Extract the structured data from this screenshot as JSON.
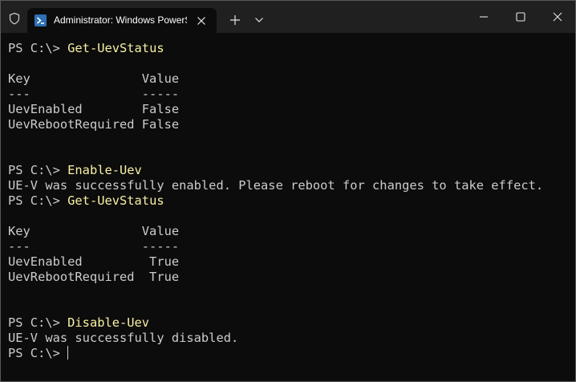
{
  "window": {
    "tab_title": "Administrator: Windows PowerShell",
    "icons": {
      "shield": "shield-icon",
      "tab": "powershell-icon",
      "tab_close": "close-icon",
      "new_tab": "plus-icon",
      "dropdown": "chevron-down-icon",
      "minimize": "minimize-icon",
      "maximize": "maximize-icon",
      "close": "close-icon"
    }
  },
  "colors": {
    "background": "#0c0c0c",
    "titlebar": "#202020",
    "text": "#cccccc",
    "command": "#f9f1a5"
  },
  "terminal": {
    "prompt": "PS C:\\> ",
    "lines": [
      {
        "prompt": "PS C:\\> ",
        "cmd": "Get-UevStatus"
      },
      {
        "text": ""
      },
      {
        "text": "Key               Value"
      },
      {
        "text": "---               -----"
      },
      {
        "text": "UevEnabled        False"
      },
      {
        "text": "UevRebootRequired False"
      },
      {
        "text": ""
      },
      {
        "text": ""
      },
      {
        "prompt": "PS C:\\> ",
        "cmd": "Enable-Uev"
      },
      {
        "text": "UE-V was successfully enabled. Please reboot for changes to take effect."
      },
      {
        "prompt": "PS C:\\> ",
        "cmd": "Get-UevStatus"
      },
      {
        "text": ""
      },
      {
        "text": "Key               Value"
      },
      {
        "text": "---               -----"
      },
      {
        "text": "UevEnabled         True"
      },
      {
        "text": "UevRebootRequired  True"
      },
      {
        "text": ""
      },
      {
        "text": ""
      },
      {
        "prompt": "PS C:\\> ",
        "cmd": "Disable-Uev"
      },
      {
        "text": "UE-V was successfully disabled."
      }
    ]
  }
}
